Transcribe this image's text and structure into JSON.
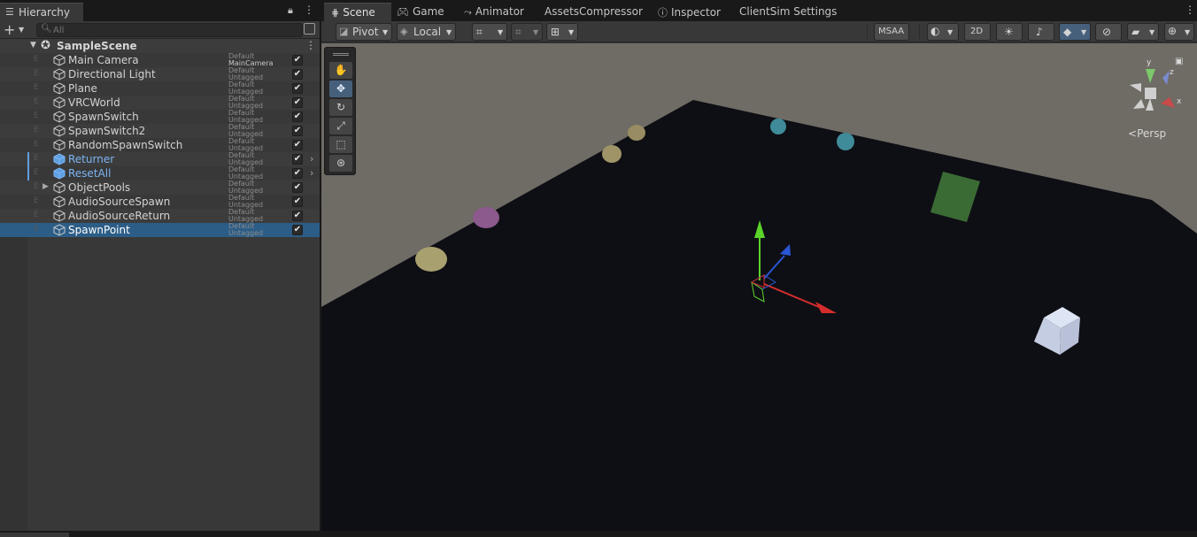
{
  "hierarchy": {
    "tab_label": "Hierarchy",
    "tab_icon": "list-icon",
    "search_placeholder": "All",
    "scene_name": "SampleScene",
    "items": [
      {
        "name": "Main Camera",
        "layer": "Default",
        "tag": "MainCamera",
        "active": true,
        "prefab": false,
        "has_children": false,
        "selected": false
      },
      {
        "name": "Directional Light",
        "layer": "Default",
        "tag": "Untagged",
        "active": true,
        "prefab": false,
        "has_children": false,
        "selected": false
      },
      {
        "name": "Plane",
        "layer": "Default",
        "tag": "Untagged",
        "active": true,
        "prefab": false,
        "has_children": false,
        "selected": false
      },
      {
        "name": "VRCWorld",
        "layer": "Default",
        "tag": "Untagged",
        "active": true,
        "prefab": false,
        "has_children": false,
        "selected": false
      },
      {
        "name": "SpawnSwitch",
        "layer": "Default",
        "tag": "Untagged",
        "active": true,
        "prefab": false,
        "has_children": false,
        "selected": false
      },
      {
        "name": "SpawnSwitch2",
        "layer": "Default",
        "tag": "Untagged",
        "active": true,
        "prefab": false,
        "has_children": false,
        "selected": false
      },
      {
        "name": "RandomSpawnSwitch",
        "layer": "Default",
        "tag": "Untagged",
        "active": true,
        "prefab": false,
        "has_children": false,
        "selected": false
      },
      {
        "name": "Returner",
        "layer": "Default",
        "tag": "Untagged",
        "active": true,
        "prefab": true,
        "has_children": false,
        "selected": false
      },
      {
        "name": "ResetAll",
        "layer": "Default",
        "tag": "Untagged",
        "active": true,
        "prefab": true,
        "has_children": false,
        "selected": false
      },
      {
        "name": "ObjectPools",
        "layer": "Default",
        "tag": "Untagged",
        "active": true,
        "prefab": false,
        "has_children": true,
        "selected": false
      },
      {
        "name": "AudioSourceSpawn",
        "layer": "Default",
        "tag": "Untagged",
        "active": true,
        "prefab": false,
        "has_children": false,
        "selected": false
      },
      {
        "name": "AudioSourceReturn",
        "layer": "Default",
        "tag": "Untagged",
        "active": true,
        "prefab": false,
        "has_children": false,
        "selected": false
      },
      {
        "name": "SpawnPoint",
        "layer": "Default",
        "tag": "Untagged",
        "active": true,
        "prefab": false,
        "has_children": false,
        "selected": true
      }
    ]
  },
  "scene_tabs": [
    {
      "label": "Scene",
      "icon": "grid-icon",
      "active": true
    },
    {
      "label": "Game",
      "icon": "gamepad-icon",
      "active": false
    },
    {
      "label": "Animator",
      "icon": "animator-icon",
      "active": false
    },
    {
      "label": "AssetsCompressor",
      "icon": "",
      "active": false
    },
    {
      "label": "Inspector",
      "icon": "info-icon",
      "active": false
    },
    {
      "label": "ClientSim Settings",
      "icon": "",
      "active": false
    }
  ],
  "scene_toolbar": {
    "pivot_label": "Pivot",
    "local_label": "Local",
    "msaa_label": "MSAA",
    "twod_label": "2D"
  },
  "viewport": {
    "camera_mode": "Persp",
    "gizmo_axes": {
      "y": "y",
      "z": "z",
      "x": "x"
    },
    "ground_color": "#0e0f14",
    "background_color": "#6f6b65",
    "transform_tool": "move",
    "colors": {
      "x_axis": "#d52d2d",
      "y_axis": "#5bd42a",
      "z_axis": "#2a56d4",
      "selection": "#2c5d87",
      "prefab_text": "#7cb4f3"
    }
  }
}
